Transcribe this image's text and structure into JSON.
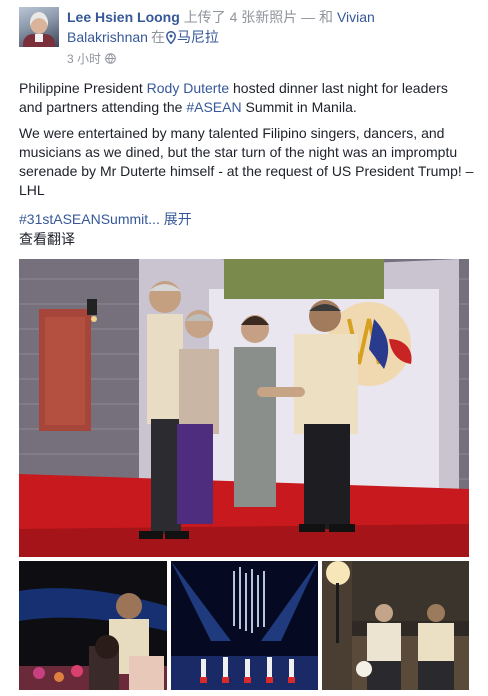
{
  "post": {
    "author": "Lee Hsien Loong",
    "action": "上传了 4 张新照片 — 和",
    "tagged_first": "Vivian",
    "tagged_last": "Balakrishnan",
    "location_prefix": "在",
    "location": "马尼拉",
    "time": "3 小时",
    "para1_a": "Philippine President ",
    "para1_link1": "Rody Duterte",
    "para1_b": " hosted dinner last night for leaders and partners attending the ",
    "para1_link2": "#ASEAN",
    "para1_c": " Summit in Manila.",
    "para2": "We were entertained by many talented Filipino singers, dancers, and musicians as we dined, but the star turn of the night was an impromptu serenade by Mr Duterte himself - at the request of US President Trump! – LHL",
    "hashtag": "#31stASEANSummit...",
    "see_more": "展开",
    "translate": "查看翻译"
  },
  "icons": {
    "location": "map-pin-icon",
    "privacy": "globe-icon"
  },
  "colors": {
    "link": "#365899",
    "text": "#1d2129",
    "meta": "#90949c",
    "carpet": "#c8191e"
  }
}
